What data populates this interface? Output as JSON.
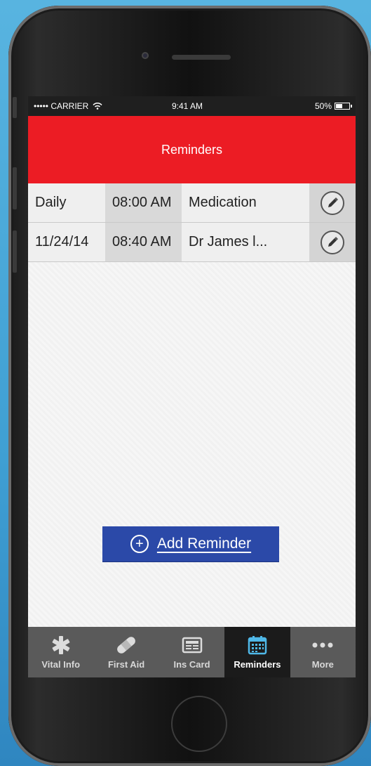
{
  "status_bar": {
    "carrier": "••••• CARRIER",
    "time": "9:41 AM",
    "battery": "50%",
    "battery_level": 0.5
  },
  "nav": {
    "title": "Reminders"
  },
  "reminders": [
    {
      "date": "Daily",
      "time": "08:00 AM",
      "title": "Medication"
    },
    {
      "date": "11/24/14",
      "time": "08:40 AM",
      "title": "Dr James l..."
    }
  ],
  "add_button": {
    "label": "Add Reminder"
  },
  "tabs": [
    {
      "label": "Vital Info",
      "icon": "asterisk-icon",
      "active": false
    },
    {
      "label": "First Aid",
      "icon": "bandage-icon",
      "active": false
    },
    {
      "label": "Ins Card",
      "icon": "id-card-icon",
      "active": false
    },
    {
      "label": "Reminders",
      "icon": "calendar-icon",
      "active": true
    },
    {
      "label": "More",
      "icon": "more-dots-icon",
      "active": false
    }
  ],
  "colors": {
    "accent_red": "#ec1c24",
    "button_blue": "#2b49a8",
    "tabbar": "#5a5a5a",
    "tab_active": "#1b1b1b",
    "active_icon": "#4fb8e8"
  }
}
